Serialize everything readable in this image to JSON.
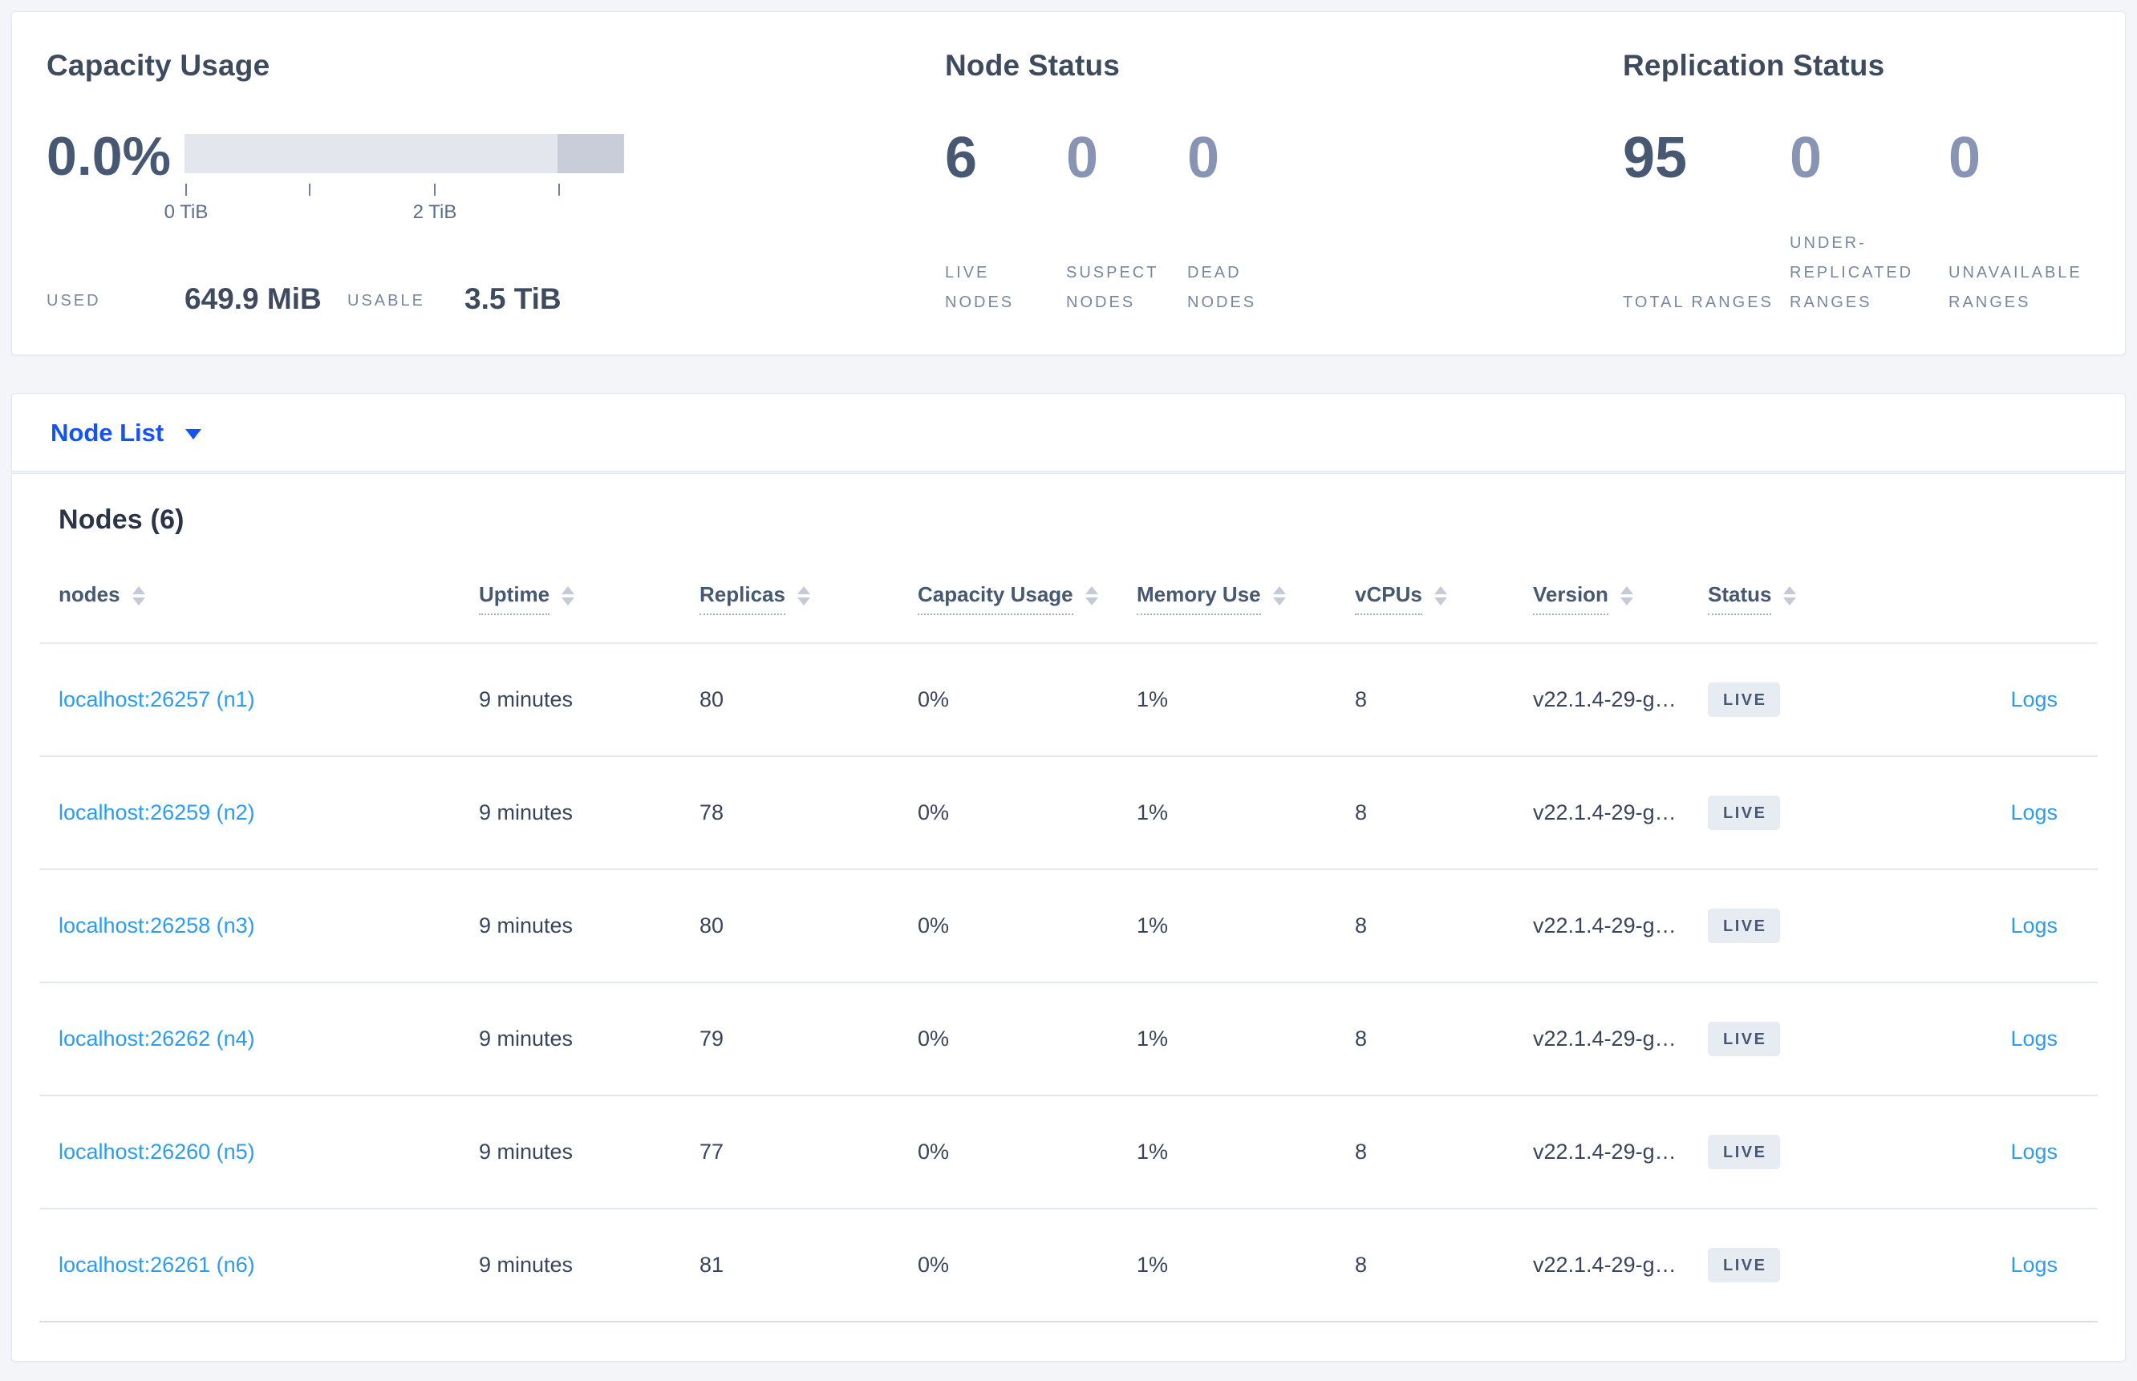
{
  "summary": {
    "capacity": {
      "title": "Capacity Usage",
      "percent": "0.0%",
      "bar": {
        "range_tib": [
          0,
          3.5
        ],
        "tick_interval_tib": 1,
        "tick_labels": [
          "0 TiB",
          "2 TiB"
        ],
        "used_fraction": 0.0
      },
      "used_label": "USED",
      "used_value": "649.9 MiB",
      "usable_label": "USABLE",
      "usable_value": "3.5 TiB"
    },
    "node_status": {
      "title": "Node Status",
      "stats": [
        {
          "value": "6",
          "label": "LIVE NODES"
        },
        {
          "value": "0",
          "label": "SUSPECT NODES"
        },
        {
          "value": "0",
          "label": "DEAD NODES"
        }
      ]
    },
    "replication": {
      "title": "Replication Status",
      "stats": [
        {
          "value": "95",
          "label": "TOTAL RANGES"
        },
        {
          "value": "0",
          "label": "UNDER-REPLICATED RANGES"
        },
        {
          "value": "0",
          "label": "UNAVAILABLE RANGES"
        }
      ]
    }
  },
  "view_selector": {
    "label": "Node List"
  },
  "nodes_section": {
    "heading": "Nodes (6)",
    "columns": [
      "nodes",
      "Uptime",
      "Replicas",
      "Capacity Usage",
      "Memory Use",
      "vCPUs",
      "Version",
      "Status"
    ],
    "logs_label": "Logs",
    "rows": [
      {
        "node": "localhost:26257 (n1)",
        "uptime": "9 minutes",
        "replicas": "80",
        "capacity": "0%",
        "memory": "1%",
        "vcpus": "8",
        "version": "v22.1.4-29-g…",
        "status": "LIVE"
      },
      {
        "node": "localhost:26259 (n2)",
        "uptime": "9 minutes",
        "replicas": "78",
        "capacity": "0%",
        "memory": "1%",
        "vcpus": "8",
        "version": "v22.1.4-29-g…",
        "status": "LIVE"
      },
      {
        "node": "localhost:26258 (n3)",
        "uptime": "9 minutes",
        "replicas": "80",
        "capacity": "0%",
        "memory": "1%",
        "vcpus": "8",
        "version": "v22.1.4-29-g…",
        "status": "LIVE"
      },
      {
        "node": "localhost:26262 (n4)",
        "uptime": "9 minutes",
        "replicas": "79",
        "capacity": "0%",
        "memory": "1%",
        "vcpus": "8",
        "version": "v22.1.4-29-g…",
        "status": "LIVE"
      },
      {
        "node": "localhost:26260 (n5)",
        "uptime": "9 minutes",
        "replicas": "77",
        "capacity": "0%",
        "memory": "1%",
        "vcpus": "8",
        "version": "v22.1.4-29-g…",
        "status": "LIVE"
      },
      {
        "node": "localhost:26261 (n6)",
        "uptime": "9 minutes",
        "replicas": "81",
        "capacity": "0%",
        "memory": "1%",
        "vcpus": "8",
        "version": "v22.1.4-29-g…",
        "status": "LIVE"
      }
    ]
  },
  "colors": {
    "page_background": "#f3f5f9",
    "accent_blue": "#1453f5",
    "link_blue": "#2b9cf2",
    "badge_background": "#e7ebf2",
    "badge_text": "#475872",
    "bar_light": "#e3e6ec",
    "bar_dark": "#c9cdd9"
  }
}
